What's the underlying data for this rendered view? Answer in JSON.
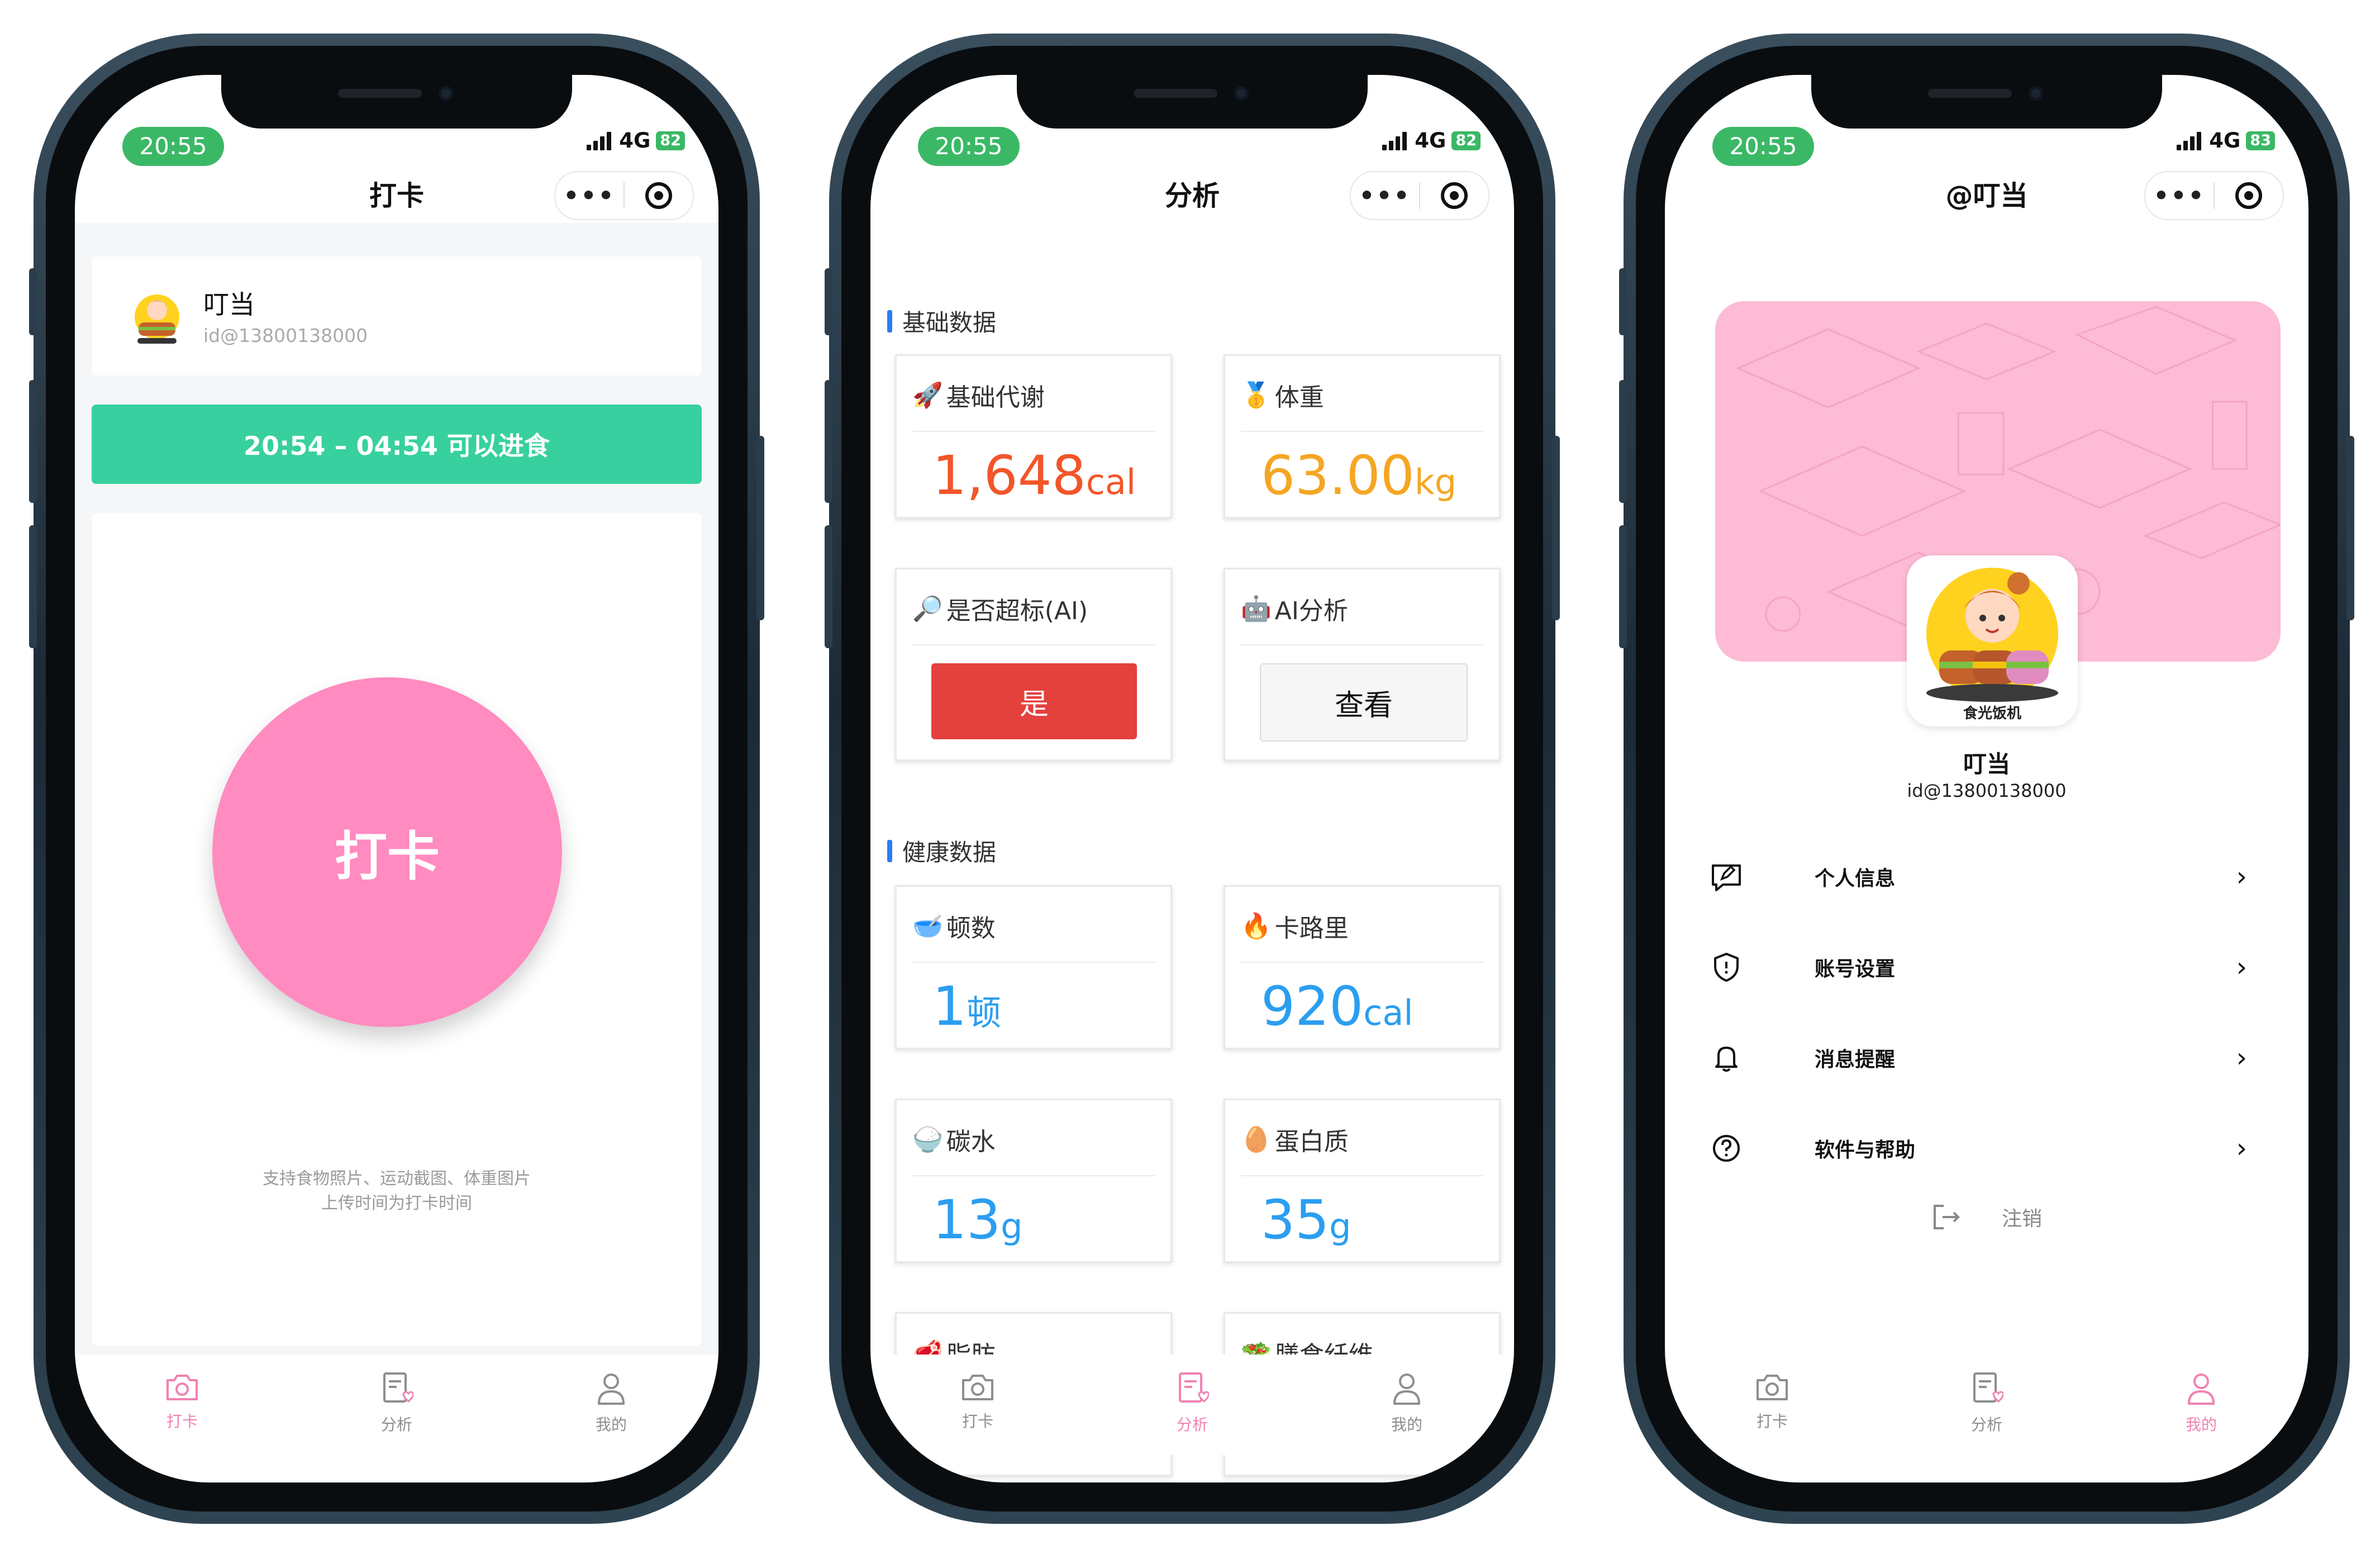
{
  "status": {
    "time": "20:55",
    "network": "4G"
  },
  "screens": [
    {
      "battery": "82",
      "title": "打卡",
      "user": {
        "name": "叮当",
        "id": "id@13800138000"
      },
      "eat_window": "20:54 – 04:54 可以进食",
      "punch_label": "打卡",
      "hint_line1": "支持食物照片、运动截图、体重图片",
      "hint_line2": "上传时间为打卡时间"
    },
    {
      "battery": "82",
      "title": "分析",
      "section_basic": "基础数据",
      "section_health": "健康数据",
      "basic": [
        {
          "emoji": "🚀",
          "label": "基础代谢",
          "value": "1,648",
          "unit": "cal",
          "color": "#f2552a"
        },
        {
          "emoji": "🥇",
          "label": "体重",
          "value": "63.00",
          "unit": "kg",
          "color": "#f5a623"
        }
      ],
      "over_label": "是否超标(AI)",
      "over_emoji": "🔎",
      "over_value": "是",
      "ai_label": "AI分析",
      "ai_emoji": "🤖",
      "ai_button": "查看",
      "health": [
        {
          "emoji": "🥣",
          "label": "顿数",
          "value": "1",
          "unit": "顿",
          "color": "#2b9ef0"
        },
        {
          "emoji": "🔥",
          "label": "卡路里",
          "value": "920",
          "unit": "cal",
          "color": "#2b9ef0"
        },
        {
          "emoji": "🍚",
          "label": "碳水",
          "value": "13",
          "unit": "g",
          "color": "#2b9ef0"
        },
        {
          "emoji": "🥚",
          "label": "蛋白质",
          "value": "35",
          "unit": "g",
          "color": "#2b9ef0"
        },
        {
          "emoji": "🥩",
          "label": "脂肪",
          "value": "",
          "unit": "",
          "color": "#2b9ef0"
        },
        {
          "emoji": "🥗",
          "label": "膳食纤维",
          "value": "",
          "unit": "",
          "color": "#2b9ef0"
        }
      ]
    },
    {
      "battery": "83",
      "title": "@叮当",
      "avatar_caption": "食光饭机",
      "user": {
        "name": "叮当",
        "id": "id@13800138000"
      },
      "menu": [
        {
          "icon": "edit-chat-icon",
          "label": "个人信息"
        },
        {
          "icon": "shield-icon",
          "label": "账号设置"
        },
        {
          "icon": "bell-icon",
          "label": "消息提醒"
        },
        {
          "icon": "help-icon",
          "label": "软件与帮助"
        }
      ],
      "logout": "注销"
    }
  ],
  "tabs": [
    {
      "icon": "camera-icon",
      "label": "打卡"
    },
    {
      "icon": "analysis-icon",
      "label": "分析"
    },
    {
      "icon": "profile-icon",
      "label": "我的"
    }
  ],
  "colors": {
    "accent_pink": "#f083b3",
    "green": "#37d09e",
    "blue": "#2b9ef0",
    "red": "#e4403c"
  }
}
